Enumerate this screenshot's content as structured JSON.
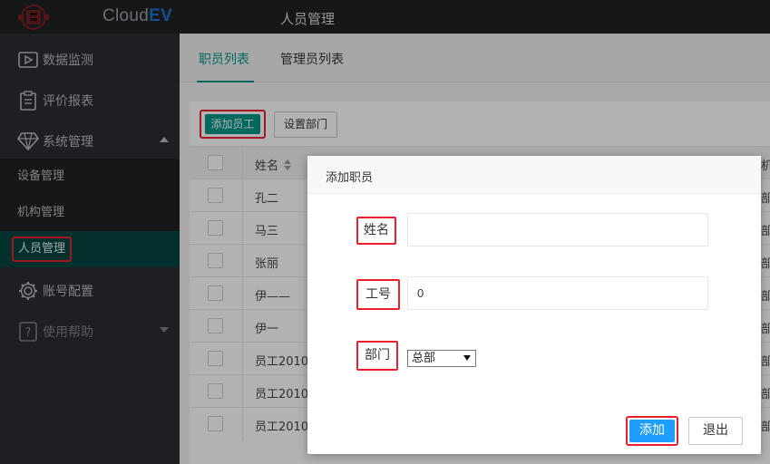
{
  "header": {
    "logo_icon": "cloudev-logo-icon",
    "brand_prefix": "Cloud",
    "brand_suffix": "EV",
    "page_title": "人员管理"
  },
  "sidebar": {
    "items": [
      {
        "label": "数据监测",
        "icon": "video-monitor-icon"
      },
      {
        "label": "评价报表",
        "icon": "clipboard-icon"
      },
      {
        "label": "系统管理",
        "icon": "diamond-icon",
        "expanded": true
      },
      {
        "label": "账号配置",
        "icon": "gear-icon"
      },
      {
        "label": "使用帮助",
        "icon": "help-icon",
        "expanded": false
      }
    ],
    "sub_items": [
      {
        "label": "设备管理"
      },
      {
        "label": "机构管理"
      },
      {
        "label": "人员管理",
        "active": true
      }
    ]
  },
  "tabs": [
    {
      "label": "职员列表",
      "active": true
    },
    {
      "label": "管理员列表",
      "active": false
    }
  ],
  "toolbar": {
    "add_label": "添加员工",
    "dept_label": "设置部门"
  },
  "table": {
    "header_name": "姓名",
    "header_right": "机",
    "rows": [
      {
        "name": "孔二",
        "right": "部"
      },
      {
        "name": "马三",
        "right": "部"
      },
      {
        "name": "张丽",
        "right": "部"
      },
      {
        "name": "伊——",
        "right": "部"
      },
      {
        "name": "伊一",
        "right": "部"
      },
      {
        "name": "员工2010",
        "right": "部"
      },
      {
        "name": "员工2010",
        "right": "部"
      },
      {
        "name": "员工2010",
        "right": "部"
      }
    ]
  },
  "modal": {
    "title": "添加职员",
    "name_label": "姓名",
    "name_value": "",
    "id_label": "工号",
    "id_value": "0",
    "dept_label": "部门",
    "dept_selected": "总部",
    "submit_label": "添加",
    "exit_label": "退出"
  },
  "colors": {
    "primary": "#009688",
    "submit": "#1e9fff",
    "highlight": "#e8212e",
    "sidebar_bg": "#2a2d31",
    "header_bg": "#1f2124"
  }
}
